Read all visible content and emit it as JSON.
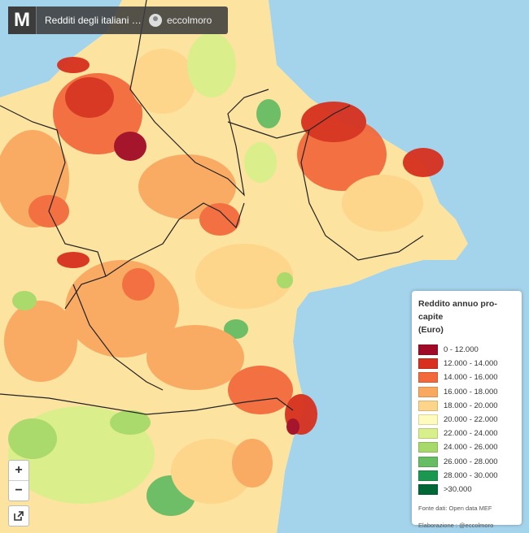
{
  "header": {
    "logo": "M",
    "title": "Redditi degli italiani per C...",
    "author": "eccolmoro"
  },
  "map": {
    "sea_color": "#a4d3ec",
    "border_color": "#222222"
  },
  "controls": {
    "zoom_in": "+",
    "zoom_out": "−"
  },
  "legend": {
    "title_line1": "Reddito annuo pro-capite",
    "title_line2": "(Euro)",
    "items": [
      {
        "label": "0 - 12.000",
        "color": "#a10a26"
      },
      {
        "label": "12.000 - 14.000",
        "color": "#d7301f"
      },
      {
        "label": "14.000 - 16.000",
        "color": "#f26a3c"
      },
      {
        "label": "16.000 - 18.000",
        "color": "#f9a860"
      },
      {
        "label": "18.000 - 20.000",
        "color": "#fdd58a"
      },
      {
        "label": "20.000 - 22.000",
        "color": "#fefbbd"
      },
      {
        "label": "22.000 - 24.000",
        "color": "#d9ef8b"
      },
      {
        "label": "24.000 - 26.000",
        "color": "#a6d96a"
      },
      {
        "label": "26.000 - 28.000",
        "color": "#66bd63"
      },
      {
        "label": "28.000 - 30.000",
        "color": "#1a9850"
      },
      {
        "label": ">30.000",
        "color": "#006837"
      }
    ],
    "source": "Fonte dati: Open data MEF",
    "credit": "Elaborazione : @eccolmoro"
  }
}
